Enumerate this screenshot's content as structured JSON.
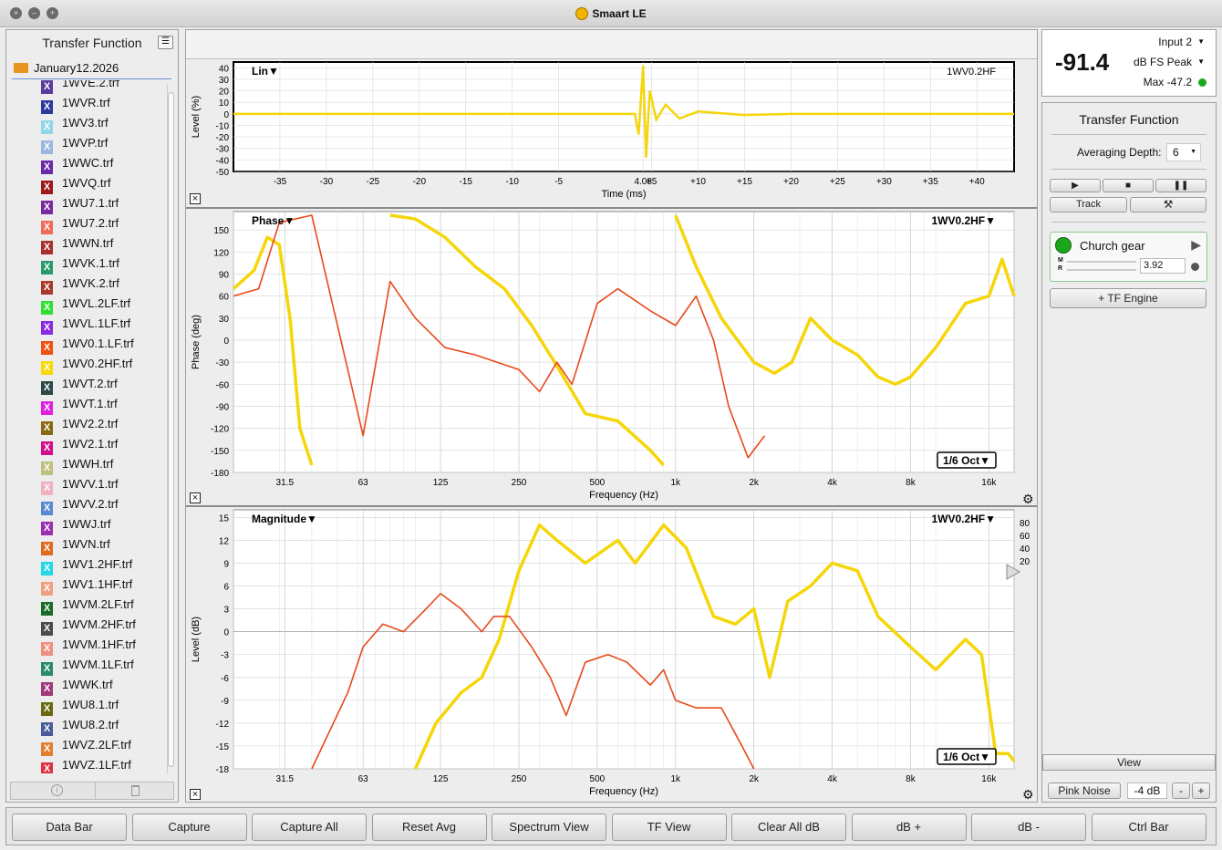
{
  "app": {
    "title": "Smaart LE"
  },
  "sidebar": {
    "title": "Transfer Function",
    "folder": "January12.2026",
    "files": [
      {
        "name": "1WVE.2.trf",
        "color": "#5b3a9e"
      },
      {
        "name": "1WVR.trf",
        "color": "#2a3a9e"
      },
      {
        "name": "1WV3.trf",
        "color": "#8fd6e6"
      },
      {
        "name": "1WVP.trf",
        "color": "#9bb7e0"
      },
      {
        "name": "1WWC.trf",
        "color": "#6a2aa8"
      },
      {
        "name": "1WVQ.trf",
        "color": "#9e1a1a"
      },
      {
        "name": "1WU7.1.trf",
        "color": "#7a2aa0"
      },
      {
        "name": "1WU7.2.trf",
        "color": "#f06a5a"
      },
      {
        "name": "1WWN.trf",
        "color": "#a83030"
      },
      {
        "name": "1WVK.1.trf",
        "color": "#2a9a6a"
      },
      {
        "name": "1WVK.2.trf",
        "color": "#a83a2a"
      },
      {
        "name": "1WVL.2LF.trf",
        "color": "#30e030"
      },
      {
        "name": "1WVL.1LF.trf",
        "color": "#8a2ae0"
      },
      {
        "name": "1WV0.1.LF.trf",
        "color": "#f05010"
      },
      {
        "name": "1WV0.2HF.trf",
        "color": "#f8d800"
      },
      {
        "name": "1WVT.2.trf",
        "color": "#2a4a4a"
      },
      {
        "name": "1WVT.1.trf",
        "color": "#e020e0"
      },
      {
        "name": "1WV2.2.trf",
        "color": "#8a6a10"
      },
      {
        "name": "1WV2.1.trf",
        "color": "#d0108a"
      },
      {
        "name": "1WWH.trf",
        "color": "#c0c080"
      },
      {
        "name": "1WVV.1.trf",
        "color": "#f0b0c0"
      },
      {
        "name": "1WVV.2.trf",
        "color": "#5a8ad0"
      },
      {
        "name": "1WWJ.trf",
        "color": "#9a30b0"
      },
      {
        "name": "1WVN.trf",
        "color": "#e06a20"
      },
      {
        "name": "1WV1.2HF.trf",
        "color": "#20d8e8"
      },
      {
        "name": "1WV1.1HF.trf",
        "color": "#f0a080"
      },
      {
        "name": "1WVM.2LF.trf",
        "color": "#1a6a2a"
      },
      {
        "name": "1WVM.2HF.trf",
        "color": "#4a4a4a"
      },
      {
        "name": "1WVM.1HF.trf",
        "color": "#f09080"
      },
      {
        "name": "1WVM.1LF.trf",
        "color": "#2a8a6a"
      },
      {
        "name": "1WWK.trf",
        "color": "#a03a7a"
      },
      {
        "name": "1WU8.1.trf",
        "color": "#6a6a10"
      },
      {
        "name": "1WU8.2.trf",
        "color": "#4a5a9a"
      },
      {
        "name": "1WVZ.2LF.trf",
        "color": "#e08030"
      },
      {
        "name": "1WVZ.1LF.trf",
        "color": "#e03040"
      }
    ],
    "footer_icons": [
      "info-icon",
      "trash-icon"
    ]
  },
  "impulse": {
    "mode_label": "Lin▼",
    "trace_label": "1WV0.2HF",
    "ylabel": "Level (%)",
    "xlabel": "Time (ms)",
    "yticks": [
      "40",
      "30",
      "20",
      "10",
      "0",
      "-10",
      "-20",
      "-30",
      "-40",
      "-50"
    ],
    "xticks": [
      "-35",
      "-30",
      "-25",
      "-20",
      "-15",
      "-10",
      "-5",
      "4.08",
      "+5",
      "+10",
      "+15",
      "+20",
      "+25",
      "+30",
      "+35",
      "+40"
    ]
  },
  "phase": {
    "mode_label": "Phase▼",
    "trace_label": "1WV0.2HF▼",
    "ylabel": "Phase (deg)",
    "xlabel": "Frequency (Hz)",
    "yticks": [
      "150",
      "120",
      "90",
      "60",
      "30",
      "0",
      "-30",
      "-60",
      "-90",
      "-120",
      "-150",
      "-180"
    ],
    "xticks": [
      "31.5",
      "63",
      "125",
      "250",
      "500",
      "1k",
      "2k",
      "4k",
      "8k",
      "16k"
    ],
    "smoothing": "1/6 Oct▼"
  },
  "magnitude": {
    "mode_label": "Magnitude▼",
    "trace_label": "1WV0.2HF▼",
    "ylabel": "Level (dB)",
    "xlabel": "Frequency (Hz)",
    "yticks": [
      "15",
      "12",
      "9",
      "6",
      "3",
      "0",
      "-3",
      "-6",
      "-9",
      "-12",
      "-15",
      "-18"
    ],
    "xticks": [
      "31.5",
      "63",
      "125",
      "250",
      "500",
      "1k",
      "2k",
      "4k",
      "8k",
      "16k"
    ],
    "coherence_ticks": [
      "80",
      "60",
      "40",
      "20"
    ],
    "smoothing": "1/6 Oct▼"
  },
  "meter": {
    "value": "-91.4",
    "input": "Input 2",
    "mode": "dB FS Peak",
    "max": "Max -47.2",
    "status_color": "#1aa81a"
  },
  "control": {
    "title": "Transfer Function",
    "avg_label": "Averaging Depth:",
    "avg_value": "6",
    "track_label": "Track",
    "measurement_name": "Church gear",
    "delay_value": "3.92",
    "m_label": "M",
    "r_label": "R",
    "add_engine": "+ TF Engine",
    "view_label": "View",
    "noise_label": "Pink Noise",
    "noise_level": "-4 dB",
    "minus": "-",
    "plus": "+"
  },
  "bottom": {
    "buttons": [
      "Data Bar",
      "Capture",
      "Capture All",
      "Reset Avg",
      "Spectrum View",
      "TF View",
      "Clear All dB",
      "dB +",
      "dB -",
      "Ctrl Bar"
    ]
  },
  "colors": {
    "trace_yellow": "#f5d60a",
    "trace_red": "#e8481c",
    "grid": "#d9d9d9"
  },
  "chart_data": [
    {
      "type": "line",
      "title": "Lin",
      "xlabel": "Time (ms)",
      "ylabel": "Level (%)",
      "xlim": [
        -40,
        44
      ],
      "ylim": [
        -50,
        45
      ],
      "series": [
        {
          "name": "1WV0.2HF",
          "x": [
            -40,
            -20,
            0,
            3.2,
            3.6,
            4.08,
            4.4,
            4.8,
            5.5,
            6.5,
            8,
            10,
            15,
            20,
            30,
            40,
            44
          ],
          "values": [
            0,
            0,
            0,
            0,
            -18,
            42,
            -38,
            20,
            -5,
            8,
            -4,
            2,
            -1,
            0,
            0,
            0,
            0
          ]
        }
      ]
    },
    {
      "type": "line",
      "title": "Phase",
      "xlabel": "Frequency (Hz)",
      "ylabel": "Phase (deg)",
      "xscale": "log",
      "xlim": [
        20,
        20000
      ],
      "ylim": [
        -180,
        175
      ],
      "series": [
        {
          "name": "1WV0.2HF",
          "x": [
            20,
            24,
            27,
            30,
            33,
            36,
            40
          ],
          "values": [
            70,
            95,
            140,
            130,
            30,
            -120,
            -170
          ]
        },
        {
          "name": "1WV0.2HF",
          "x": [
            80,
            100,
            130,
            170,
            220,
            280,
            350,
            450,
            600,
            800,
            900
          ],
          "values": [
            170,
            165,
            140,
            100,
            70,
            20,
            -35,
            -100,
            -110,
            -150,
            -170
          ]
        },
        {
          "name": "1WV0.2HF",
          "x": [
            1000,
            1200,
            1500,
            2000,
            2400,
            2800,
            3300,
            4000,
            5000,
            6000,
            7000,
            8000,
            10000,
            13000,
            16000,
            18000,
            20000
          ],
          "values": [
            170,
            100,
            30,
            -30,
            -45,
            -30,
            30,
            0,
            -20,
            -50,
            -60,
            -50,
            -10,
            50,
            60,
            110,
            60
          ]
        },
        {
          "name": "1WVT.1.trf",
          "x": [
            20,
            25,
            30,
            40,
            55,
            63,
            80,
            100,
            130,
            170,
            250,
            300,
            350,
            400,
            500,
            600,
            800,
            1000,
            1200,
            1400,
            1600,
            1900,
            2200
          ],
          "values": [
            60,
            70,
            160,
            170,
            -40,
            -130,
            80,
            30,
            -10,
            -20,
            -40,
            -70,
            -30,
            -60,
            50,
            70,
            40,
            20,
            60,
            0,
            -90,
            -160,
            -130
          ]
        }
      ]
    },
    {
      "type": "line",
      "title": "Magnitude",
      "xlabel": "Frequency (Hz)",
      "ylabel": "Level (dB)",
      "xscale": "log",
      "xlim": [
        20,
        20000
      ],
      "ylim": [
        -18,
        16
      ],
      "series": [
        {
          "name": "1WV0.2HF",
          "x": [
            100,
            120,
            150,
            180,
            210,
            250,
            300,
            350,
            450,
            600,
            700,
            900,
            1100,
            1400,
            1700,
            2000,
            2300,
            2700,
            3300,
            4000,
            5000,
            6000,
            8000,
            10000,
            13000,
            15000,
            17000,
            19000,
            20000
          ],
          "values": [
            -18,
            -12,
            -8,
            -6,
            -1,
            8,
            14,
            12,
            9,
            12,
            9,
            14,
            11,
            2,
            1,
            3,
            -6,
            4,
            6,
            9,
            8,
            2,
            -2,
            -5,
            -1,
            -3,
            -16,
            -16,
            -17
          ]
        },
        {
          "name": "1WVT.1.trf",
          "x": [
            40,
            55,
            63,
            75,
            90,
            110,
            125,
            150,
            180,
            200,
            230,
            280,
            330,
            380,
            450,
            550,
            650,
            800,
            900,
            1000,
            1200,
            1500,
            1800,
            2000
          ],
          "values": [
            -18,
            -8,
            -2,
            1,
            0,
            3,
            5,
            3,
            0,
            2,
            2,
            -2,
            -6,
            -11,
            -4,
            -3,
            -4,
            -7,
            -5,
            -9,
            -10,
            -10,
            -15,
            -18
          ]
        }
      ]
    }
  ]
}
